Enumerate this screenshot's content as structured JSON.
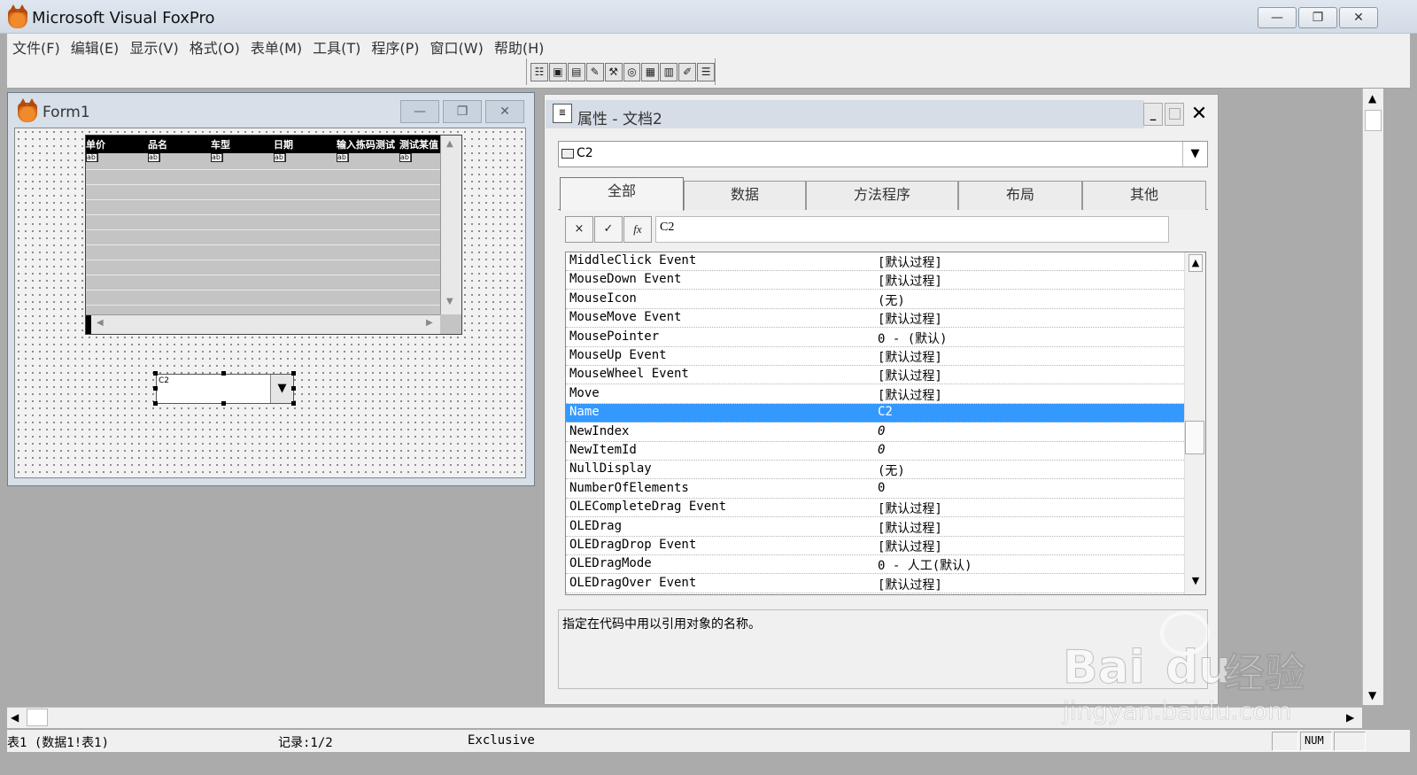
{
  "app": {
    "title": "Microsoft Visual FoxPro"
  },
  "window_controls": {
    "minimize": "—",
    "restore": "❐",
    "close": "✕"
  },
  "menu": [
    "文件(F)",
    "编辑(E)",
    "显示(V)",
    "格式(O)",
    "表单(M)",
    "工具(T)",
    "程序(P)",
    "窗口(W)",
    "帮助(H)"
  ],
  "toolbar": {
    "buttons": [
      "list-icon",
      "data-env-icon",
      "props-icon",
      "code-icon",
      "builder-icon",
      "autoformat-icon",
      "color-icon",
      "layout-icon",
      "wizard-icon",
      "form-wizard-icon"
    ]
  },
  "form1": {
    "title": "Form1",
    "grid": {
      "columns": [
        "单价",
        "品名",
        "车型",
        "日期",
        "输入拣码测试",
        "测试某值"
      ],
      "cell_marker": "ab|"
    },
    "combo": {
      "value": "C2"
    }
  },
  "properties": {
    "title": "属性 - 文档2",
    "object": "C2",
    "tabs": [
      "全部",
      "数据",
      "方法程序",
      "布局",
      "其他"
    ],
    "active_tab": "全部",
    "edit_value": "C2",
    "edit_buttons": {
      "cancel": "×",
      "accept": "✓",
      "fx": "fx"
    },
    "rows": [
      {
        "name": "MiddleClick Event",
        "value": "[默认过程]"
      },
      {
        "name": "MouseDown Event",
        "value": "[默认过程]"
      },
      {
        "name": "MouseIcon",
        "value": "(无)"
      },
      {
        "name": "MouseMove Event",
        "value": "[默认过程]"
      },
      {
        "name": "MousePointer",
        "value": "0 - (默认)"
      },
      {
        "name": "MouseUp Event",
        "value": "[默认过程]"
      },
      {
        "name": "MouseWheel Event",
        "value": "[默认过程]"
      },
      {
        "name": "Move",
        "value": "[默认过程]"
      },
      {
        "name": "Name",
        "value": "C2",
        "selected": true
      },
      {
        "name": "NewIndex",
        "value": "0",
        "italic": true
      },
      {
        "name": "NewItemId",
        "value": "0",
        "italic": true
      },
      {
        "name": "NullDisplay",
        "value": "(无)"
      },
      {
        "name": "NumberOfElements",
        "value": "0"
      },
      {
        "name": "OLECompleteDrag Event",
        "value": "[默认过程]"
      },
      {
        "name": "OLEDrag",
        "value": "[默认过程]"
      },
      {
        "name": "OLEDragDrop Event",
        "value": "[默认过程]"
      },
      {
        "name": "OLEDragMode",
        "value": "0 - 人工(默认)"
      },
      {
        "name": "OLEDragOver Event",
        "value": "[默认过程]"
      }
    ],
    "description": "指定在代码中用以引用对象的名称。"
  },
  "status": {
    "table": "表1 (数据1!表1)",
    "record": "记录:1/2",
    "mode": "Exclusive",
    "num": "NUM"
  },
  "watermark": {
    "brand": "Bai",
    "brand2": "du",
    "cn": "经验",
    "url": "jingyan.baidu.com"
  }
}
